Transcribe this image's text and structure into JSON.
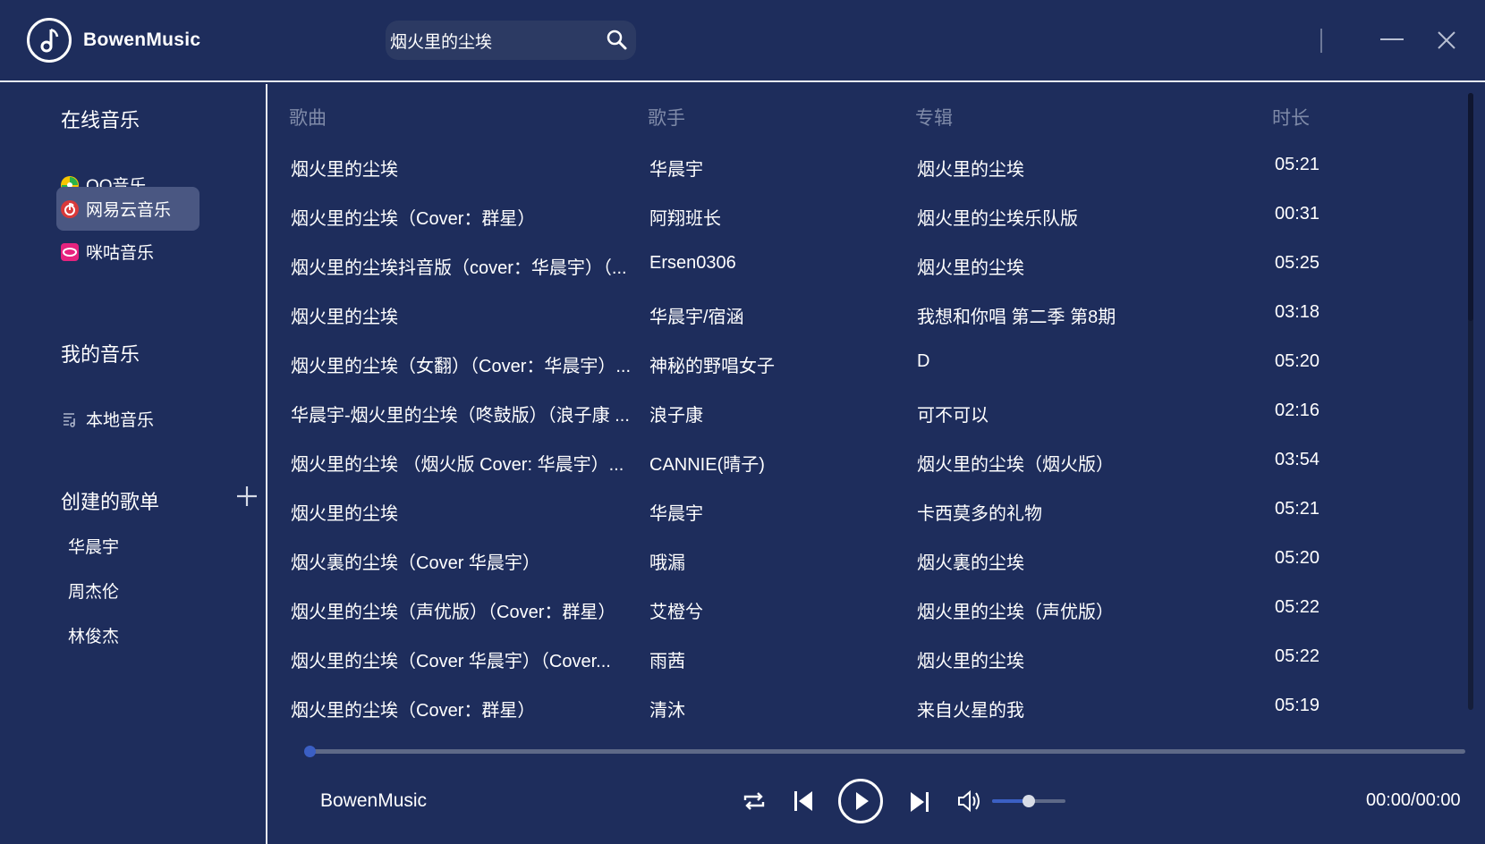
{
  "app": {
    "name": "BowenMusic"
  },
  "search": {
    "value": "烟火里的尘埃"
  },
  "sidebar": {
    "online_title": "在线音乐",
    "online_items": [
      {
        "label": "QQ音乐",
        "icon": "qq-music-icon"
      },
      {
        "label": "网易云音乐",
        "icon": "netease-music-icon",
        "active": true
      },
      {
        "label": "咪咕音乐",
        "icon": "migu-music-icon"
      }
    ],
    "my_title": "我的音乐",
    "my_items": [
      {
        "label": "本地音乐",
        "icon": "local-music-icon"
      }
    ],
    "playlists_title": "创建的歌单",
    "playlists": [
      "华晨宇",
      "周杰伦",
      "林俊杰"
    ]
  },
  "table": {
    "headers": {
      "song": "歌曲",
      "artist": "歌手",
      "album": "专辑",
      "duration": "时长"
    },
    "rows": [
      {
        "song": "烟火里的尘埃",
        "artist": "华晨宇",
        "album": "烟火里的尘埃",
        "duration": "05:21"
      },
      {
        "song": "烟火里的尘埃（Cover：群星）",
        "artist": "阿翔班长",
        "album": "烟火里的尘埃乐队版",
        "duration": "00:31"
      },
      {
        "song": "烟火里的尘埃抖音版（cover：华晨宇）（...",
        "artist": "Ersen0306",
        "album": "烟火里的尘埃",
        "duration": "05:25"
      },
      {
        "song": "烟火里的尘埃",
        "artist": "华晨宇/宿涵",
        "album": "我想和你唱 第二季 第8期",
        "duration": "03:18"
      },
      {
        "song": "烟火里的尘埃（女翻）（Cover：华晨宇）...",
        "artist": "神秘的野唱女子",
        "album": "D",
        "duration": "05:20"
      },
      {
        "song": "华晨宇-烟火里的尘埃（咚鼓版）（浪子康 ...",
        "artist": "浪子康",
        "album": "可不可以",
        "duration": "02:16"
      },
      {
        "song": "烟火里的尘埃 （烟火版 Cover: 华晨宇）...",
        "artist": "CANNIE(晴子)",
        "album": "烟火里的尘埃（烟火版）",
        "duration": "03:54"
      },
      {
        "song": "烟火里的尘埃",
        "artist": "华晨宇",
        "album": "卡西莫多的礼物",
        "duration": "05:21"
      },
      {
        "song": "烟火裏的尘埃（Cover 华晨宇）",
        "artist": "哦漏",
        "album": "烟火裏的尘埃",
        "duration": "05:20"
      },
      {
        "song": "烟火里的尘埃（声优版）（Cover：群星）",
        "artist": "艾橙兮",
        "album": "烟火里的尘埃（声优版）",
        "duration": "05:22"
      },
      {
        "song": "烟火里的尘埃（Cover 华晨宇）（Cover...",
        "artist": "雨茜",
        "album": "烟火里的尘埃",
        "duration": "05:22"
      },
      {
        "song": "烟火里的尘埃（Cover：群星）",
        "artist": "清沐",
        "album": "来自火星的我",
        "duration": "05:19"
      }
    ]
  },
  "player": {
    "title": "BowenMusic",
    "time": "00:00/00:00",
    "progress": 0,
    "volume": 0.5
  },
  "colors": {
    "background": "#1e2d5c",
    "accent": "#3b5fc4",
    "active_item": "#4a5782"
  }
}
